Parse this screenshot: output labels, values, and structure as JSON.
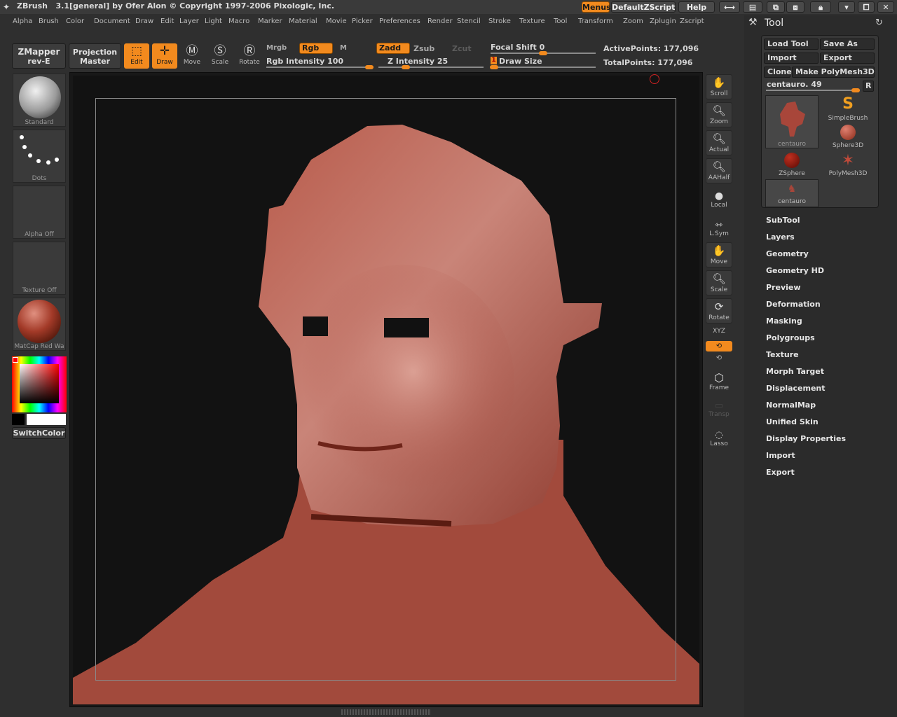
{
  "app": {
    "title": "ZBrush   3.1[general] by Ofer Alon © Copyright 1997-2006 Pixologic, Inc.",
    "menus_btn": "Menus",
    "script_btn": "DefaultZScript",
    "help_btn": "Help"
  },
  "menubar": [
    "Alpha",
    "Brush",
    "Color",
    "Document",
    "Draw",
    "Edit",
    "Layer",
    "Light",
    "Macro",
    "Marker",
    "Material",
    "Movie",
    "Picker",
    "Preferences",
    "Render",
    "Stencil",
    "Stroke",
    "Texture",
    "Tool",
    "Transform",
    "Zoom",
    "Zplugin",
    "Zscript"
  ],
  "toolbar": {
    "zmapper": "ZMapper",
    "zmapper_rev": "rev-E",
    "projection": "Projection",
    "projection2": "Master",
    "edit": "Edit",
    "draw": "Draw",
    "move": "Move",
    "scale": "Scale",
    "rotate": "Rotate",
    "mrgb": "Mrgb",
    "rgb": "Rgb",
    "m": "M",
    "rgb_intensity": "Rgb Intensity 100",
    "zadd": "Zadd",
    "zsub": "Zsub",
    "zcut": "Zcut",
    "z_intensity": "Z Intensity 25",
    "focal_shift": "Focal Shift 0",
    "draw_size": "Draw Size",
    "draw_size_value": "1",
    "active_points": "ActivePoints: 177,096",
    "total_points": "TotalPoints: 177,096"
  },
  "left_shelf": {
    "brush": "Standard",
    "stroke": "Dots",
    "alpha": "Alpha  Off",
    "texture": "Texture  Off",
    "material": "MatCap  Red  Wa",
    "switch_color": "SwitchColor"
  },
  "right_shelf": [
    "Scroll",
    "Zoom",
    "Actual",
    "AAHalf",
    "Local",
    "L.Sym",
    "Move",
    "Scale",
    "Rotate",
    "XYZ",
    "Frame",
    "Transp",
    "Lasso"
  ],
  "tool_panel": {
    "title": "Tool",
    "load_tool": "Load Tool",
    "save_as": "Save As",
    "import": "Import",
    "export": "Export",
    "clone": "Clone",
    "make_polymesh": "Make PolyMesh3D",
    "current_tool": "centauro. 49",
    "r_btn": "R",
    "tools": [
      "centauro",
      "SimpleBrush",
      "Sphere3D",
      "ZSphere",
      "PolyMesh3D",
      "centauro"
    ],
    "sections": [
      "SubTool",
      "Layers",
      "Geometry",
      "Geometry HD",
      "Preview",
      "Deformation",
      "Masking",
      "Polygroups",
      "Texture",
      "Morph Target",
      "Displacement",
      "NormalMap",
      "Unified Skin",
      "Display Properties",
      "Import",
      "Export"
    ]
  },
  "colors": {
    "accent": "#f28a1e",
    "sculpt": "#a8463a"
  }
}
